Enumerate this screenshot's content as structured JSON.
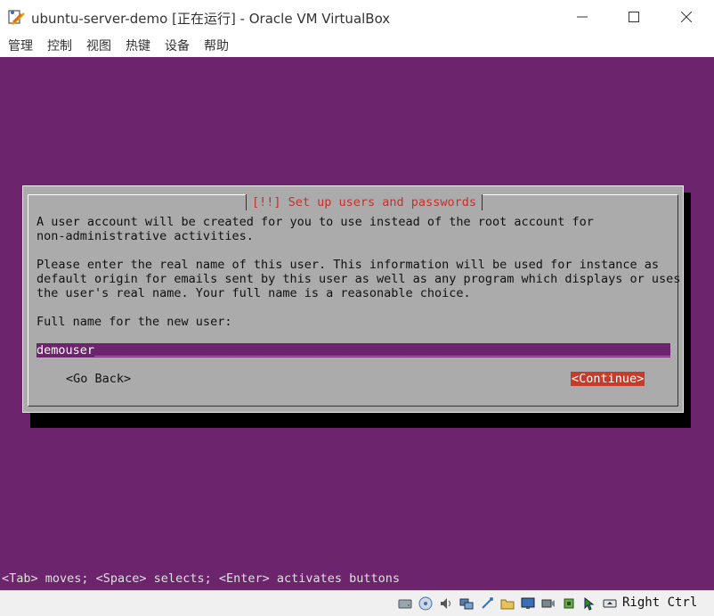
{
  "window": {
    "title": "ubuntu-server-demo [正在运行] - Oracle VM VirtualBox",
    "app_icon": "virtualbox-icon"
  },
  "menu": {
    "items": [
      {
        "label": "管理"
      },
      {
        "label": "控制"
      },
      {
        "label": "视图"
      },
      {
        "label": "热键"
      },
      {
        "label": "设备"
      },
      {
        "label": "帮助"
      }
    ]
  },
  "vm": {
    "background_color": "#6c246c",
    "dialog": {
      "title": "[!!] Set up users and passwords",
      "lines": [
        "A user account will be created for you to use instead of the root account for",
        "non-administrative activities.",
        "",
        "Please enter the real name of this user. This information will be used for instance as",
        "default origin for emails sent by this user as well as any program which displays or uses",
        "the user's real name. Your full name is a reasonable choice.",
        "",
        "Full name for the new user:"
      ],
      "input_value": "demouser",
      "back_button": "<Go Back>",
      "continue_button": "<Continue>"
    },
    "hint": "<Tab> moves; <Space> selects; <Enter> activates buttons"
  },
  "statusbar": {
    "icons": [
      "hard-disk-icon",
      "optical-disk-icon",
      "audio-icon",
      "network-icon",
      "usb-icon",
      "shared-folders-icon",
      "display-icon",
      "video-capture-icon",
      "cpu-icon",
      "mouse-integration-icon",
      "keyboard-icon"
    ],
    "host_key": "Right Ctrl"
  }
}
